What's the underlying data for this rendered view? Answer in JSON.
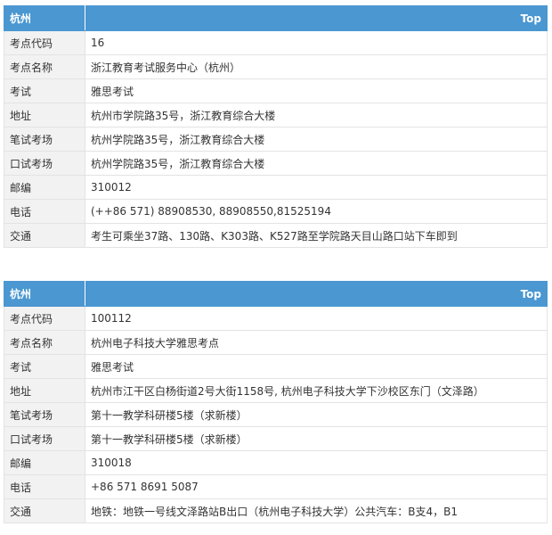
{
  "venues": [
    {
      "city": "杭州",
      "top_label": "Top",
      "rows": [
        {
          "label": "考点代码",
          "value": "16"
        },
        {
          "label": "考点名称",
          "value": "浙江教育考试服务中心（杭州）"
        },
        {
          "label": "考试",
          "value": "雅思考试"
        },
        {
          "label": "地址",
          "value": "杭州市学院路35号，浙江教育综合大楼"
        },
        {
          "label": "笔试考场",
          "value": "杭州学院路35号，浙江教育综合大楼"
        },
        {
          "label": "口试考场",
          "value": "杭州学院路35号，浙江教育综合大楼"
        },
        {
          "label": "邮编",
          "value": "310012"
        },
        {
          "label": "电话",
          "value": "(++86 571) 88908530, 88908550,81525194"
        },
        {
          "label": "交通",
          "value": "考生可乘坐37路、130路、K303路、K527路至学院路天目山路口站下车即到"
        }
      ]
    },
    {
      "city": "杭州",
      "top_label": "Top",
      "rows": [
        {
          "label": "考点代码",
          "value": "100112"
        },
        {
          "label": "考点名称",
          "value": "杭州电子科技大学雅思考点"
        },
        {
          "label": "考试",
          "value": "雅思考试"
        },
        {
          "label": "地址",
          "value": "杭州市江干区白杨街道2号大街1158号, 杭州电子科技大学下沙校区东门（文泽路）"
        },
        {
          "label": "笔试考场",
          "value": "第十一教学科研楼5楼（求新楼）"
        },
        {
          "label": "口试考场",
          "value": "第十一教学科研楼5楼（求新楼）"
        },
        {
          "label": "邮编",
          "value": "310018"
        },
        {
          "label": "电话",
          "value": "+86 571 8691 5087"
        },
        {
          "label": "交通",
          "value": "地铁：地铁一号线文泽路站B出口（杭州电子科技大学）公共汽车：B支4，B1"
        }
      ]
    }
  ]
}
